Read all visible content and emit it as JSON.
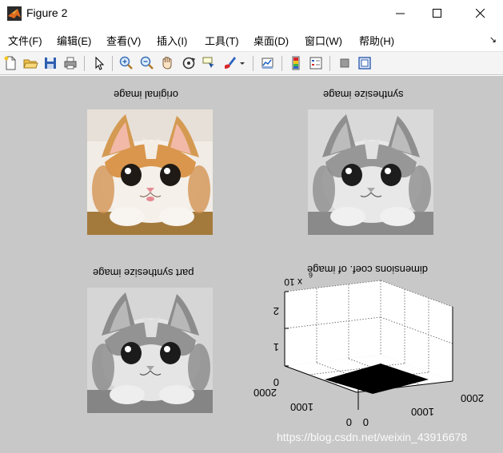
{
  "window": {
    "title": "Figure 2",
    "controls": {
      "minimize": "minimize",
      "maximize": "maximize",
      "close": "close"
    }
  },
  "menu": {
    "items": [
      "文件(F)",
      "编辑(E)",
      "查看(V)",
      "插入(I)",
      "工具(T)",
      "桌面(D)",
      "窗口(W)",
      "帮助(H)"
    ]
  },
  "toolbar": {
    "icons": [
      "new-figure-icon",
      "open-file-icon",
      "save-icon",
      "print-icon",
      "pointer-icon",
      "zoom-in-icon",
      "zoom-out-icon",
      "pan-hand-icon",
      "rotate-3d-icon",
      "data-cursor-icon",
      "brush-icon",
      "dropdown-arrow-icon",
      "link-plot-icon",
      "colorbar-icon",
      "legend-icon",
      "hide-plot-tools-icon",
      "show-plot-tools-icon"
    ]
  },
  "subplots": [
    {
      "title": "original image",
      "image": "color cat photo",
      "flipped": true
    },
    {
      "title": "synthesize image",
      "image": "grayscale cat photo",
      "flipped": true
    },
    {
      "title": "part synthesize image",
      "image": "grayscale cat photo",
      "flipped": true
    },
    {
      "title": "dimensions coef. of image",
      "image": "3-D surface plot",
      "flipped": true
    }
  ],
  "plot3d": {
    "exponent_label": "x 10",
    "exponent_power": "6",
    "z_ticks": [
      "2",
      "1",
      "0"
    ],
    "x_ticks": [
      "2000",
      "1000",
      "0"
    ],
    "y_ticks": [
      "0",
      "1000",
      "2000"
    ]
  },
  "colors": {
    "figure_background": "#c8c8c8",
    "axes_background": "#ffffff",
    "surface_fill": "#000000"
  },
  "watermark": "https://blog.csdn.net/weixin_43916678"
}
